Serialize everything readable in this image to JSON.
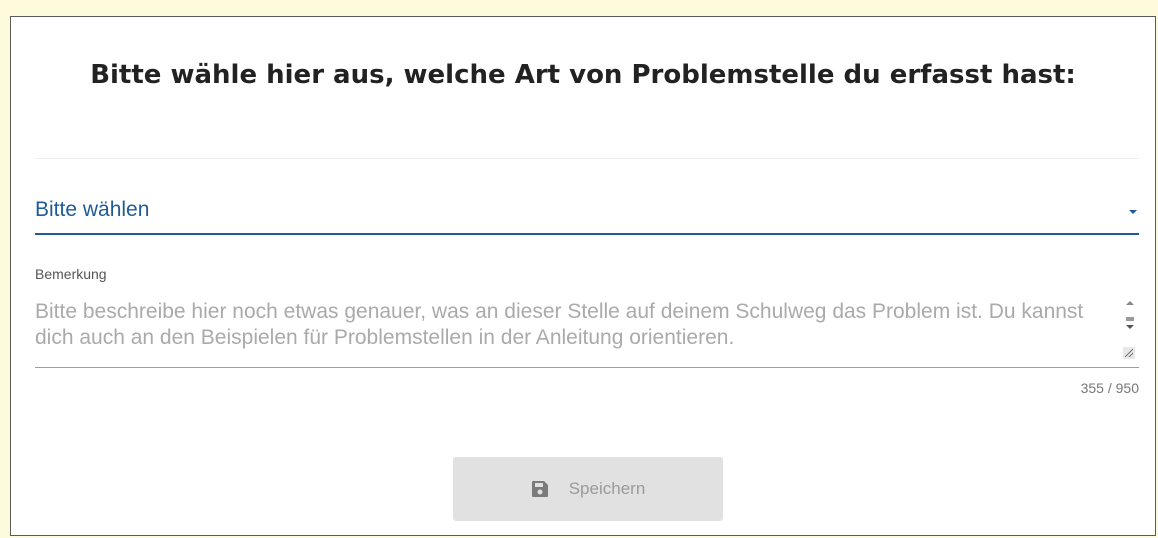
{
  "dialog": {
    "title": "Bitte wähle hier aus, welche Art von Problemstelle du erfasst hast:"
  },
  "category_select": {
    "selected_value": "Bitte wählen"
  },
  "remark": {
    "label": "Bemerkung",
    "placeholder": "Bitte beschreibe hier noch etwas genauer, was an dieser Stelle auf deinem Schulweg das Problem ist. Du kannst dich auch an den Beispielen für Problemstellen in der Anleitung orientieren.",
    "value": "",
    "counter": "355 / 950"
  },
  "actions": {
    "save_label": "Speichern",
    "save_icon": "floppy-disk-icon"
  },
  "colors": {
    "accent": "#1f5b96",
    "page_background": "#fdfbdc",
    "button_disabled": "#e1e1e1"
  }
}
